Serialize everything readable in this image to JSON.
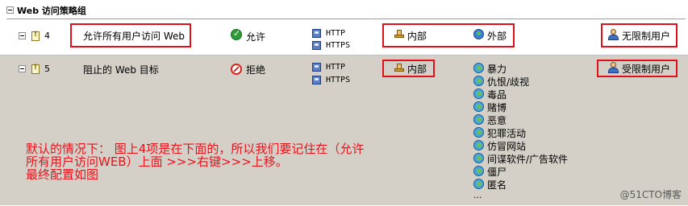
{
  "group": {
    "title": "Web 访问策略组"
  },
  "rules": [
    {
      "number": "4",
      "name": "允许所有用户访问 Web",
      "action": "允许",
      "protocols": [
        "HTTP",
        "HTTPS"
      ],
      "from": "内部",
      "to": "外部",
      "users": "无限制用户"
    },
    {
      "number": "5",
      "name": "阻止的 Web 目标",
      "action": "拒绝",
      "protocols": [
        "HTTP",
        "HTTPS"
      ],
      "from": "内部",
      "to_categories": [
        "暴力",
        "仇恨/歧视",
        "毒品",
        "赌博",
        "恶意",
        "犯罪活动",
        "仿冒网站",
        "间谍软件/广告软件",
        "僵尸",
        "匿名"
      ],
      "to_more": "...",
      "users": "受限制用户"
    }
  ],
  "annotation": {
    "line1": "默认的情况下：  图上4项是在下面的，所以我们要记住在（允许",
    "line2": "所有用户访问WEB）上面 >>>右键>>>上移。",
    "line3": "最终配置如图"
  },
  "watermark": "@51CTO博客",
  "colors": {
    "highlight_border": "#e0101a",
    "annotation_text": "#e4141c",
    "selected_row_bg": "#d4d0c8"
  },
  "icons": {
    "rule": "rule-icon",
    "allow": "check-icon",
    "deny": "deny-icon",
    "protocol": "protocol-icon",
    "internal": "network-icon",
    "external": "globe-icon",
    "users": "users-icon",
    "category": "url-category-icon"
  }
}
